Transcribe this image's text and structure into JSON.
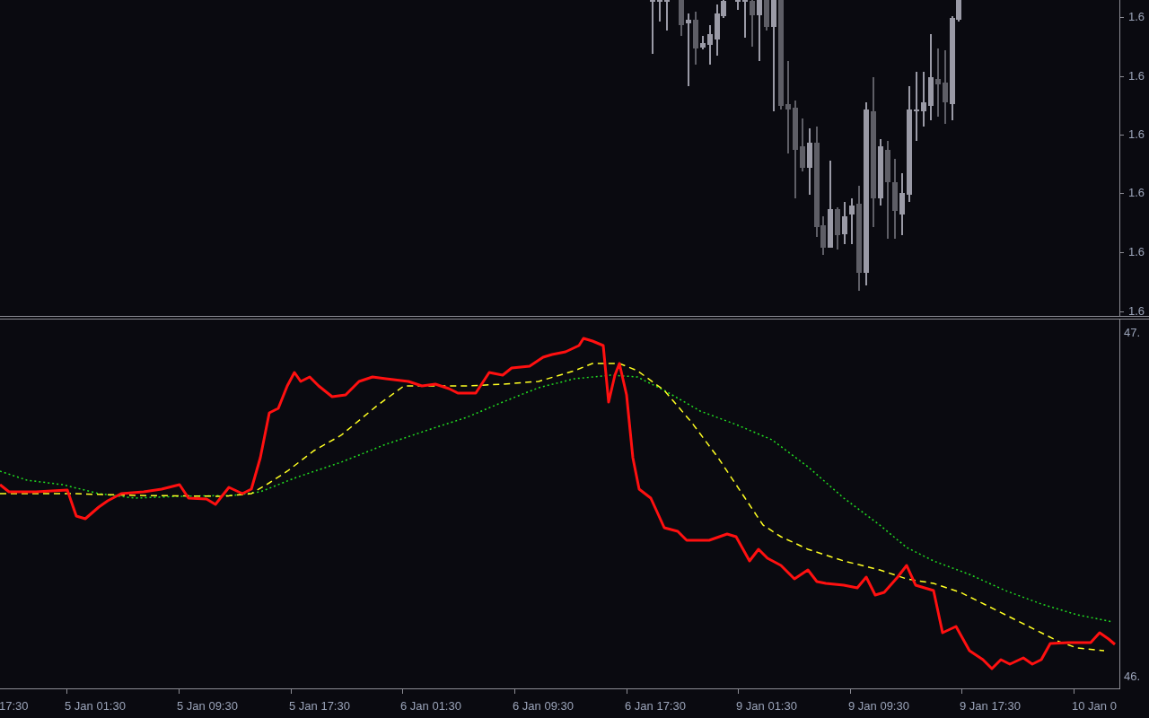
{
  "price_axis": {
    "labels": [
      "1.6",
      "1.6",
      "1.6",
      "1.6",
      "1.6",
      "1.6"
    ]
  },
  "indicator_axis": {
    "labels": [
      "47.",
      "46."
    ]
  },
  "time_axis": {
    "labels": [
      "17:30",
      "5 Jan 01:30",
      "5 Jan 09:30",
      "5 Jan 17:30",
      "6 Jan 01:30",
      "6 Jan 09:30",
      "6 Jan 17:30",
      "9 Jan 01:30",
      "9 Jan 09:30",
      "9 Jan 17:30",
      "10 Jan 0"
    ]
  }
}
